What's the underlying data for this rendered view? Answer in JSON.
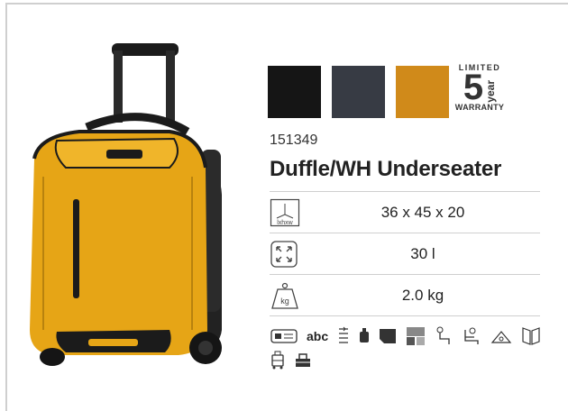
{
  "product": {
    "sku": "151349",
    "title": "Duffle/WH Underseater"
  },
  "swatches": [
    {
      "name": "black",
      "color": "#151515"
    },
    {
      "name": "graphite",
      "color": "#373b44"
    },
    {
      "name": "amber",
      "color": "#d08a1a"
    }
  ],
  "warranty": {
    "limited": "LIMITED",
    "years": "5",
    "year_label": "year",
    "warranty": "WARRANTY"
  },
  "specs": {
    "dimensions": {
      "icon_text": "lxhxw",
      "value": "36 x 45 x 20"
    },
    "volume": {
      "value": "30 l"
    },
    "weight": {
      "icon_text": "kg",
      "value": "2.0 kg"
    }
  },
  "features": {
    "text_icon_label": "abc",
    "icons": [
      "id-card-icon",
      "abc-text-icon",
      "expandable-icon",
      "lock-icon",
      "pocket-icon",
      "material-icon",
      "hanger-icon",
      "seat-icon",
      "laundry-icon",
      "divider-icon",
      "trolley-icon",
      "top-handle-icon"
    ]
  },
  "colors": {
    "bag_yellow": "#e6a516",
    "bag_dark": "#1b1b1b",
    "rule": "#cfcfcf"
  }
}
